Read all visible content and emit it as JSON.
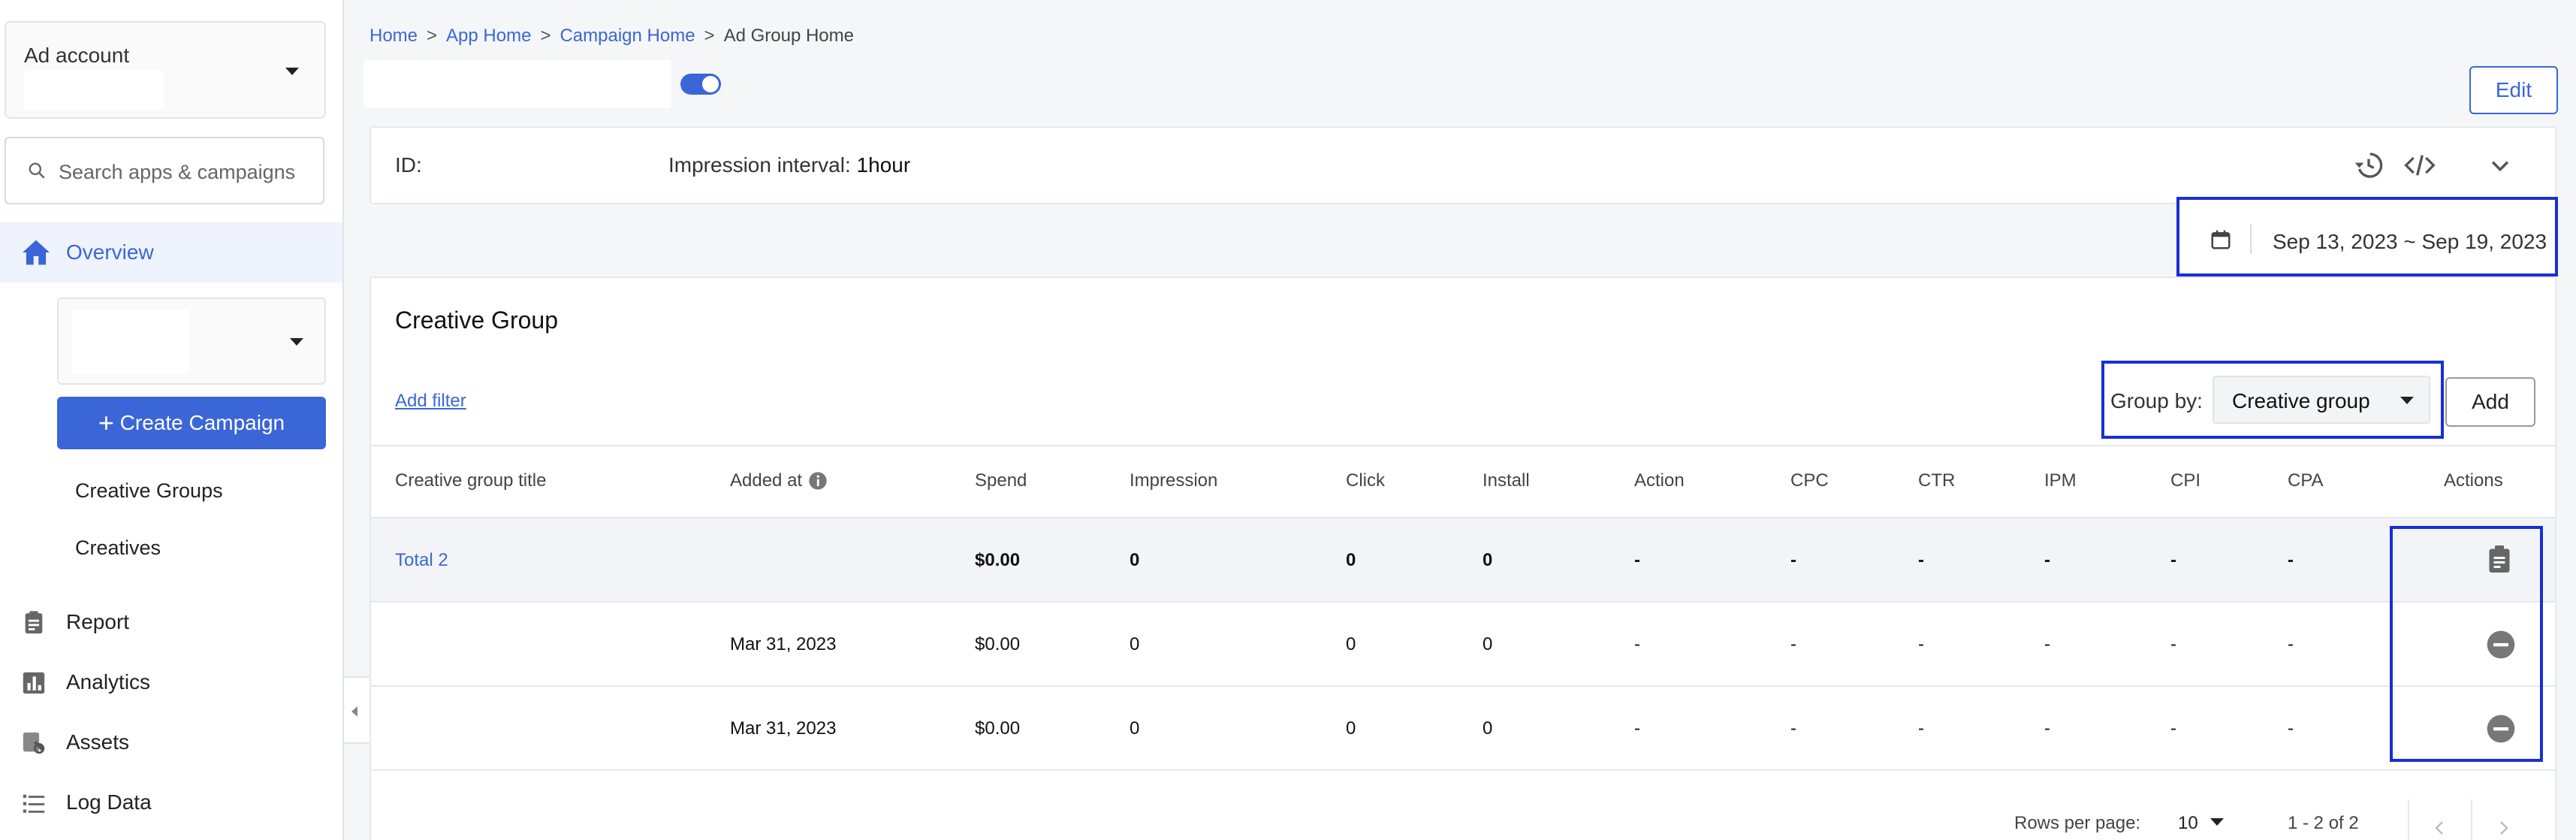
{
  "sidebar": {
    "account_label": "Ad account",
    "search_placeholder": "Search apps & campaigns",
    "overview": "Overview",
    "create_campaign": "Create Campaign",
    "sub_items": [
      "Creative Groups",
      "Creatives"
    ],
    "nav": [
      {
        "label": "Report",
        "icon": "report-icon"
      },
      {
        "label": "Analytics",
        "icon": "bar-chart-icon"
      },
      {
        "label": "Assets",
        "icon": "assets-icon"
      },
      {
        "label": "Log Data",
        "icon": "list-icon"
      }
    ]
  },
  "breadcrumb": {
    "items": [
      "Home",
      "App Home",
      "Campaign Home",
      "Ad Group Home"
    ],
    "separator": ">"
  },
  "header": {
    "edit_label": "Edit",
    "id_label": "ID:",
    "impression_label": "Impression interval:",
    "impression_value": "1hour"
  },
  "date_range": "Sep 13, 2023 ~ Sep 19, 2023",
  "creative_group": {
    "title": "Creative Group",
    "add_filter": "Add filter",
    "group_by_label": "Group by:",
    "group_by_value": "Creative group",
    "add_label": "Add",
    "columns": [
      "Creative group title",
      "Added at",
      "Spend",
      "Impression",
      "Click",
      "Install",
      "Action",
      "CPC",
      "CTR",
      "IPM",
      "CPI",
      "CPA",
      "Actions"
    ],
    "rows": [
      {
        "title": "Total 2",
        "added": "",
        "spend": "$0.00",
        "impression": "0",
        "click": "0",
        "install": "0",
        "action": "-",
        "cpc": "-",
        "ctr": "-",
        "ipm": "-",
        "cpi": "-",
        "cpa": "-"
      },
      {
        "title": "",
        "added": "Mar 31, 2023",
        "spend": "$0.00",
        "impression": "0",
        "click": "0",
        "install": "0",
        "action": "-",
        "cpc": "-",
        "ctr": "-",
        "ipm": "-",
        "cpi": "-",
        "cpa": "-"
      },
      {
        "title": "",
        "added": "Mar 31, 2023",
        "spend": "$0.00",
        "impression": "0",
        "click": "0",
        "install": "0",
        "action": "-",
        "cpc": "-",
        "ctr": "-",
        "ipm": "-",
        "cpi": "-",
        "cpa": "-"
      }
    ],
    "pagination": {
      "rows_per_page_label": "Rows per page:",
      "rows_per_page": "10",
      "range": "1 - 2 of 2"
    }
  },
  "colors": {
    "accent": "#3b66d8",
    "highlight": "#1a2fd4"
  }
}
